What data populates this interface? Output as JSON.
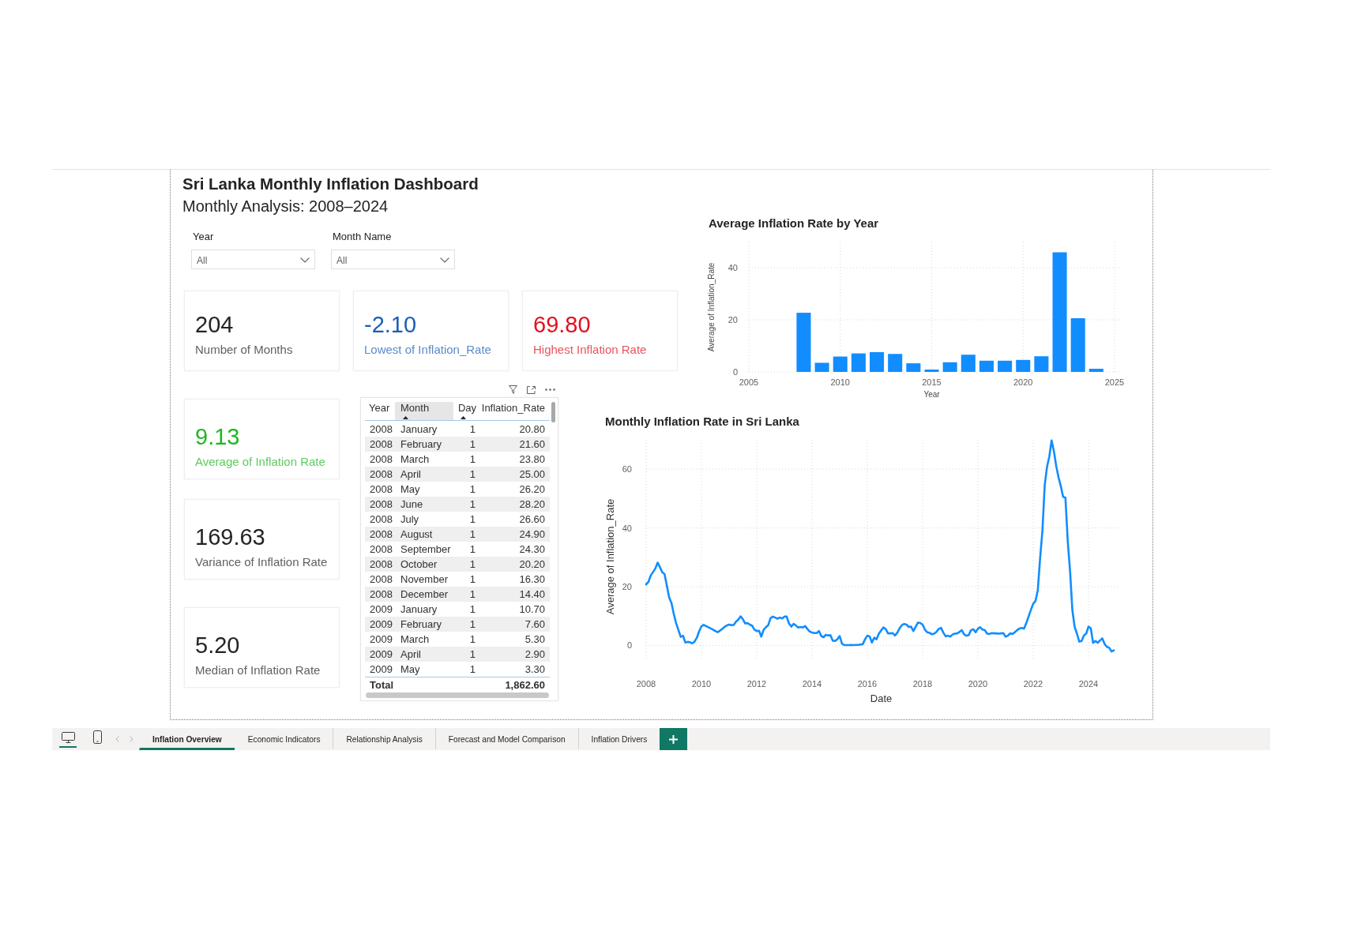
{
  "report": {
    "title": "Sri Lanka Monthly Inflation Dashboard",
    "subtitle": "Monthly Analysis: 2008–2024"
  },
  "slicers": [
    {
      "label": "Year",
      "value": "All"
    },
    {
      "label": "Month Name",
      "value": "All"
    }
  ],
  "kpi_cards": [
    {
      "value": "204",
      "label": "Number of Months",
      "color": "#252423"
    },
    {
      "value": "-2.10",
      "label": "Lowest of Inflation_Rate",
      "color": "#1a5fb4"
    },
    {
      "value": "69.80",
      "label": "Highest Inflation Rate",
      "color": "#e3101e"
    },
    {
      "value": "9.13",
      "label": "Average of Inflation Rate",
      "color": "#1fb81f"
    },
    {
      "value": "169.63",
      "label": "Variance of Inflation Rate",
      "color": "#252423"
    },
    {
      "value": "5.20",
      "label": "Median of Inflation Rate",
      "color": "#252423"
    }
  ],
  "bar_chart": {
    "chart_data": {
      "type": "bar",
      "title": "Average Inflation Rate by Year",
      "xlabel": "Year",
      "ylabel": "Average of Inflation_Rate",
      "x": [
        2008,
        2009,
        2010,
        2011,
        2012,
        2013,
        2014,
        2015,
        2016,
        2017,
        2018,
        2019,
        2020,
        2021,
        2022,
        2023,
        2024
      ],
      "series": [
        {
          "color": "#118dff",
          "values": [
            22.7,
            3.5,
            5.9,
            7.1,
            7.6,
            6.9,
            3.3,
            0.9,
            3.7,
            6.6,
            4.3,
            4.3,
            4.6,
            6.0,
            45.9,
            20.6,
            1.2
          ]
        }
      ],
      "xlim": [
        2005,
        2025
      ],
      "ylim": [
        0,
        50
      ],
      "xticks": [
        2005,
        2010,
        2015,
        2020,
        2025
      ],
      "yticks": [
        0,
        20,
        40
      ],
      "grid": true
    }
  },
  "table": {
    "columns": [
      {
        "label": "Year",
        "sorted": false,
        "highlighted": false
      },
      {
        "label": "Month",
        "sorted": true,
        "highlighted": true
      },
      {
        "label": "Day",
        "sorted": true,
        "highlighted": false
      },
      {
        "label": "Inflation_Rate",
        "sorted": false,
        "highlighted": false
      }
    ],
    "rows": [
      [
        "2008",
        "January",
        "1",
        "20.80"
      ],
      [
        "2008",
        "February",
        "1",
        "21.60"
      ],
      [
        "2008",
        "March",
        "1",
        "23.80"
      ],
      [
        "2008",
        "April",
        "1",
        "25.00"
      ],
      [
        "2008",
        "May",
        "1",
        "26.20"
      ],
      [
        "2008",
        "June",
        "1",
        "28.20"
      ],
      [
        "2008",
        "July",
        "1",
        "26.60"
      ],
      [
        "2008",
        "August",
        "1",
        "24.90"
      ],
      [
        "2008",
        "September",
        "1",
        "24.30"
      ],
      [
        "2008",
        "October",
        "1",
        "20.20"
      ],
      [
        "2008",
        "November",
        "1",
        "16.30"
      ],
      [
        "2008",
        "December",
        "1",
        "14.40"
      ],
      [
        "2009",
        "January",
        "1",
        "10.70"
      ],
      [
        "2009",
        "February",
        "1",
        "7.60"
      ],
      [
        "2009",
        "March",
        "1",
        "5.30"
      ],
      [
        "2009",
        "April",
        "1",
        "2.90"
      ],
      [
        "2009",
        "May",
        "1",
        "3.30"
      ]
    ],
    "total": {
      "label": "Total",
      "value": "1,862.60"
    }
  },
  "line_chart": {
    "chart_data": {
      "type": "line",
      "title": "Monthly Inflation Rate in Sri Lanka",
      "xlabel": "Date",
      "ylabel": "Average of Inflation_Rate",
      "x": [
        2008,
        2008.083,
        2008.167,
        2008.25,
        2008.333,
        2008.417,
        2008.5,
        2008.583,
        2008.667,
        2008.75,
        2008.833,
        2008.917,
        2009,
        2009.083,
        2009.167,
        2009.25,
        2009.333,
        2009.417,
        2009.5,
        2009.583,
        2009.667,
        2009.75,
        2009.833,
        2009.917,
        2010,
        2010.083,
        2010.167,
        2010.25,
        2010.333,
        2010.417,
        2010.5,
        2010.583,
        2010.667,
        2010.75,
        2010.833,
        2010.917,
        2011,
        2011.083,
        2011.167,
        2011.25,
        2011.333,
        2011.417,
        2011.5,
        2011.583,
        2011.667,
        2011.75,
        2011.833,
        2011.917,
        2012,
        2012.083,
        2012.167,
        2012.25,
        2012.333,
        2012.417,
        2012.5,
        2012.583,
        2012.667,
        2012.75,
        2012.833,
        2012.917,
        2013,
        2013.083,
        2013.167,
        2013.25,
        2013.333,
        2013.417,
        2013.5,
        2013.583,
        2013.667,
        2013.75,
        2013.833,
        2013.917,
        2014,
        2014.083,
        2014.167,
        2014.25,
        2014.333,
        2014.417,
        2014.5,
        2014.583,
        2014.667,
        2014.75,
        2014.833,
        2014.917,
        2015,
        2015.083,
        2015.167,
        2015.25,
        2015.333,
        2015.417,
        2015.5,
        2015.583,
        2015.667,
        2015.75,
        2015.833,
        2015.917,
        2016,
        2016.083,
        2016.167,
        2016.25,
        2016.333,
        2016.417,
        2016.5,
        2016.583,
        2016.667,
        2016.75,
        2016.833,
        2016.917,
        2017,
        2017.083,
        2017.167,
        2017.25,
        2017.333,
        2017.417,
        2017.5,
        2017.583,
        2017.667,
        2017.75,
        2017.833,
        2017.917,
        2018,
        2018.083,
        2018.167,
        2018.25,
        2018.333,
        2018.417,
        2018.5,
        2018.583,
        2018.667,
        2018.75,
        2018.833,
        2018.917,
        2019,
        2019.083,
        2019.167,
        2019.25,
        2019.333,
        2019.417,
        2019.5,
        2019.583,
        2019.667,
        2019.75,
        2019.833,
        2019.917,
        2020,
        2020.083,
        2020.167,
        2020.25,
        2020.333,
        2020.417,
        2020.5,
        2020.583,
        2020.667,
        2020.75,
        2020.833,
        2020.917,
        2021,
        2021.083,
        2021.167,
        2021.25,
        2021.333,
        2021.417,
        2021.5,
        2021.583,
        2021.667,
        2021.75,
        2021.833,
        2021.917,
        2022,
        2022.083,
        2022.167,
        2022.25,
        2022.333,
        2022.417,
        2022.5,
        2022.583,
        2022.667,
        2022.75,
        2022.833,
        2022.917,
        2023,
        2023.083,
        2023.167,
        2023.25,
        2023.333,
        2023.417,
        2023.5,
        2023.583,
        2023.667,
        2023.75,
        2023.833,
        2023.917,
        2024,
        2024.083,
        2024.167,
        2024.25,
        2024.333,
        2024.417,
        2024.5,
        2024.583,
        2024.667,
        2024.75,
        2024.833,
        2024.917
      ],
      "series": [
        {
          "color": "#118dff",
          "values": [
            20.8,
            21.6,
            23.8,
            25.0,
            26.2,
            28.2,
            26.6,
            24.9,
            24.3,
            20.2,
            16.3,
            14.4,
            10.7,
            7.6,
            5.3,
            2.9,
            3.3,
            1.0,
            1.2,
            1.1,
            0.7,
            1.3,
            2.6,
            4.8,
            6.5,
            7.0,
            6.6,
            6.2,
            5.8,
            5.4,
            4.9,
            4.5,
            5.0,
            5.6,
            6.3,
            6.8,
            7.1,
            6.9,
            7.0,
            8.1,
            8.8,
            9.9,
            8.9,
            7.5,
            7.6,
            7.1,
            6.7,
            5.4,
            4.9,
            5.0,
            3.0,
            5.4,
            6.2,
            6.9,
            9.3,
            9.8,
            9.5,
            9.1,
            9.5,
            9.2,
            9.8,
            9.8,
            7.5,
            6.4,
            7.3,
            6.8,
            6.1,
            6.3,
            6.1,
            6.6,
            5.6,
            4.7,
            4.4,
            4.2,
            4.2,
            4.9,
            3.2,
            2.8,
            3.6,
            3.4,
            3.5,
            1.6,
            1.5,
            2.1,
            3.2,
            0.6,
            0.1,
            0.1,
            0.1,
            0.2,
            0.1,
            0.2,
            0.2,
            0.3,
            0.4,
            2.1,
            3.3,
            3.1,
            1.0,
            2.6,
            2.1,
            4.0,
            5.1,
            6.1,
            5.6,
            4.1,
            4.1,
            4.2,
            3.4,
            4.3,
            5.8,
            6.9,
            7.3,
            7.1,
            6.3,
            6.4,
            4.9,
            6.4,
            7.8,
            7.6,
            7.1,
            5.4,
            4.5,
            4.3,
            3.8,
            4.0,
            4.6,
            5.6,
            6.0,
            4.3,
            3.1,
            3.3,
            3.0,
            3.7,
            4.0,
            4.1,
            4.6,
            5.2,
            3.8,
            3.3,
            3.5,
            5.2,
            5.5,
            4.5,
            5.7,
            6.2,
            5.4,
            5.2,
            4.0,
            3.9,
            4.2,
            4.1,
            4.1,
            4.0,
            4.1,
            4.2,
            3.0,
            3.3,
            4.1,
            3.9,
            4.5,
            5.2,
            5.7,
            6.0,
            5.7,
            7.6,
            9.9,
            12.1,
            14.2,
            15.1,
            18.7,
            29.8,
            39.1,
            54.6,
            60.8,
            64.3,
            69.8,
            66.0,
            61.0,
            57.2,
            54.2,
            50.6,
            50.3,
            35.3,
            25.2,
            12.0,
            6.3,
            4.0,
            1.3,
            1.5,
            3.4,
            4.0,
            6.4,
            5.9,
            0.9,
            1.5,
            0.9,
            1.7,
            2.4,
            0.5,
            -0.5,
            -0.8,
            -2.1,
            -1.7
          ]
        }
      ],
      "xlim": [
        2008,
        2025
      ],
      "ylim": [
        -5,
        70
      ],
      "xticks": [
        2008,
        2010,
        2012,
        2014,
        2016,
        2018,
        2020,
        2022,
        2024
      ],
      "yticks": [
        0,
        20,
        40,
        60
      ],
      "grid": true
    }
  },
  "view_modes": [
    {
      "kind": "desktop",
      "selected": true
    },
    {
      "kind": "mobile",
      "selected": false
    }
  ],
  "page_tabs": [
    {
      "label": "Inflation Overview",
      "selected": true
    },
    {
      "label": "Economic Indicators",
      "selected": false
    },
    {
      "label": "Relationship Analysis",
      "selected": false
    },
    {
      "label": "Forecast and Model Comparison",
      "selected": false
    },
    {
      "label": "Inflation Drivers",
      "selected": false
    }
  ]
}
